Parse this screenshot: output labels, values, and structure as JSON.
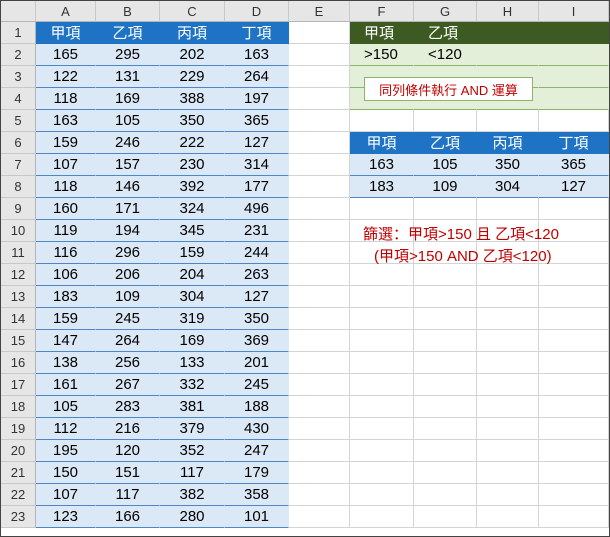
{
  "columns": [
    "A",
    "B",
    "C",
    "D",
    "E",
    "F",
    "G",
    "H",
    "I"
  ],
  "rows": [
    "1",
    "2",
    "3",
    "4",
    "5",
    "6",
    "7",
    "8",
    "9",
    "10",
    "11",
    "12",
    "13",
    "14",
    "15",
    "16",
    "17",
    "18",
    "19",
    "20",
    "21",
    "22",
    "23"
  ],
  "main_table": {
    "headers": [
      "甲項",
      "乙項",
      "丙項",
      "丁項"
    ],
    "data": [
      [
        "165",
        "295",
        "202",
        "163"
      ],
      [
        "122",
        "131",
        "229",
        "264"
      ],
      [
        "118",
        "169",
        "388",
        "197"
      ],
      [
        "163",
        "105",
        "350",
        "365"
      ],
      [
        "159",
        "246",
        "222",
        "127"
      ],
      [
        "107",
        "157",
        "230",
        "314"
      ],
      [
        "118",
        "146",
        "392",
        "177"
      ],
      [
        "160",
        "171",
        "324",
        "496"
      ],
      [
        "119",
        "194",
        "345",
        "231"
      ],
      [
        "116",
        "296",
        "159",
        "244"
      ],
      [
        "106",
        "206",
        "204",
        "263"
      ],
      [
        "183",
        "109",
        "304",
        "127"
      ],
      [
        "159",
        "245",
        "319",
        "350"
      ],
      [
        "147",
        "264",
        "169",
        "369"
      ],
      [
        "138",
        "256",
        "133",
        "201"
      ],
      [
        "161",
        "267",
        "332",
        "245"
      ],
      [
        "105",
        "283",
        "381",
        "188"
      ],
      [
        "112",
        "216",
        "379",
        "430"
      ],
      [
        "195",
        "120",
        "352",
        "247"
      ],
      [
        "150",
        "151",
        "117",
        "179"
      ],
      [
        "107",
        "117",
        "382",
        "358"
      ],
      [
        "123",
        "166",
        "280",
        "101"
      ]
    ]
  },
  "criteria": {
    "headers": [
      "甲項",
      "乙項"
    ],
    "values": [
      ">150",
      "<120"
    ],
    "note": "同列條件執行 AND 運算"
  },
  "result_table": {
    "headers": [
      "甲項",
      "乙項",
      "丙項",
      "丁項"
    ],
    "data": [
      [
        "163",
        "105",
        "350",
        "365"
      ],
      [
        "183",
        "109",
        "304",
        "127"
      ]
    ]
  },
  "annotation": {
    "line1": "篩選：甲項>150 且 乙項<120",
    "line2": "(甲項>150 AND 乙項<120)"
  },
  "colors": {
    "table_header": "#1f73c5",
    "table_band": "#dbe8f5",
    "criteria_header": "#3d5a23",
    "criteria_band": "#e3efd9",
    "annotation": "#c00000"
  }
}
